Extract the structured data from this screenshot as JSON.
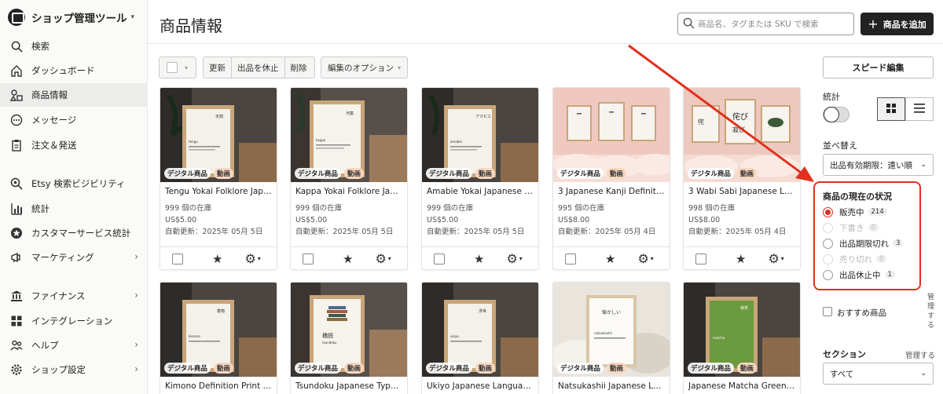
{
  "shop": {
    "name": "ショップ管理ツール",
    "caret": "▾"
  },
  "nav": [
    {
      "label": "検索",
      "icon": "search-icon"
    },
    {
      "label": "ダッシュボード",
      "icon": "home-icon"
    },
    {
      "label": "商品情報",
      "icon": "listings-icon",
      "active": true
    },
    {
      "label": "メッセージ",
      "icon": "message-icon"
    },
    {
      "label": "注文＆発送",
      "icon": "clipboard-icon"
    },
    {
      "label": "Etsy 検索ビジビリティ",
      "icon": "search-visibility-icon"
    },
    {
      "label": "統計",
      "icon": "stats-icon"
    },
    {
      "label": "カスタマーサービス統計",
      "icon": "badge-icon"
    },
    {
      "label": "マーケティング",
      "icon": "megaphone-icon",
      "arrow": "›"
    },
    {
      "label": "ファイナンス",
      "icon": "bank-icon",
      "arrow": "›"
    },
    {
      "label": "インテグレーション",
      "icon": "grid-icon"
    },
    {
      "label": "ヘルプ",
      "icon": "people-icon",
      "arrow": "›"
    },
    {
      "label": "ショップ設定",
      "icon": "settings-icon",
      "arrow": "›"
    }
  ],
  "header": {
    "title": "商品情報",
    "search_placeholder": "商品名、タグまたは SKU で検索",
    "add_label": "商品を追加",
    "add_plus": "+"
  },
  "toolbar": {
    "caret": "▾",
    "update": "更新",
    "deactivate": "出品を休止",
    "delete": "削除",
    "edit_options": "編集のオプション"
  },
  "badges": {
    "digital": "デジタル商品",
    "video": "動画"
  },
  "products": [
    {
      "title": "Tengu Yokai Folklore Japa...",
      "stock": "999 個の在庫",
      "price": "US$5.00",
      "renew": "自動更新：2025年 05月 5日"
    },
    {
      "title": "Kappa Yokai Folklore Japa...",
      "stock": "999 個の在庫",
      "price": "US$5.00",
      "renew": "自動更新：2025年 05月 5日"
    },
    {
      "title": "Amabie Yokai Japanese La...",
      "stock": "999 個の在庫",
      "price": "US$5.00",
      "renew": "自動更新：2025年 05月 5日"
    },
    {
      "title": "3 Japanese Kanji Definitio...",
      "stock": "995 個の在庫",
      "price": "US$8.00",
      "renew": "自動更新：2025年 05月 4日"
    },
    {
      "title": "3 Wabi Sabi Japanese Lan...",
      "stock": "998 個の在庫",
      "price": "US$8.00",
      "renew": "自動更新：2025年 05月 4日"
    },
    {
      "title": "Kimono Definition Print Po..."
    },
    {
      "title": "Tsundoku Japanese Typog..."
    },
    {
      "title": "Ukiyo Japanese Language..."
    },
    {
      "title": "Natsukashii Japanese Lan..."
    },
    {
      "title": "Japanese Matcha Green T..."
    }
  ],
  "card_icons": {
    "star": "★",
    "gear": "⚙",
    "caret": "▾"
  },
  "panel": {
    "speed_edit": "スピード編集",
    "stats": "統計",
    "sort_label": "並べ替え",
    "sort_value": "出品有効期限：遠い順",
    "sort_caret": "⌄",
    "status_title": "商品の現在の状況",
    "statuses": [
      {
        "label": "販売中",
        "count": "214",
        "selected": true,
        "disabled": false
      },
      {
        "label": "下書き",
        "count": "0",
        "selected": false,
        "disabled": true
      },
      {
        "label": "出品期限切れ",
        "count": "3",
        "selected": false,
        "disabled": false
      },
      {
        "label": "売り切れ",
        "count": "0",
        "selected": false,
        "disabled": true
      },
      {
        "label": "出品休止中",
        "count": "1",
        "selected": false,
        "disabled": false
      }
    ],
    "featured": "おすすめ商品",
    "manage_vertical": "管理する",
    "section_label": "セクション",
    "section_manage": "管理する",
    "section_value": "すべて",
    "section_caret": "⌄"
  },
  "colors": {
    "accent": "#e0301e",
    "dark": "#222222"
  }
}
